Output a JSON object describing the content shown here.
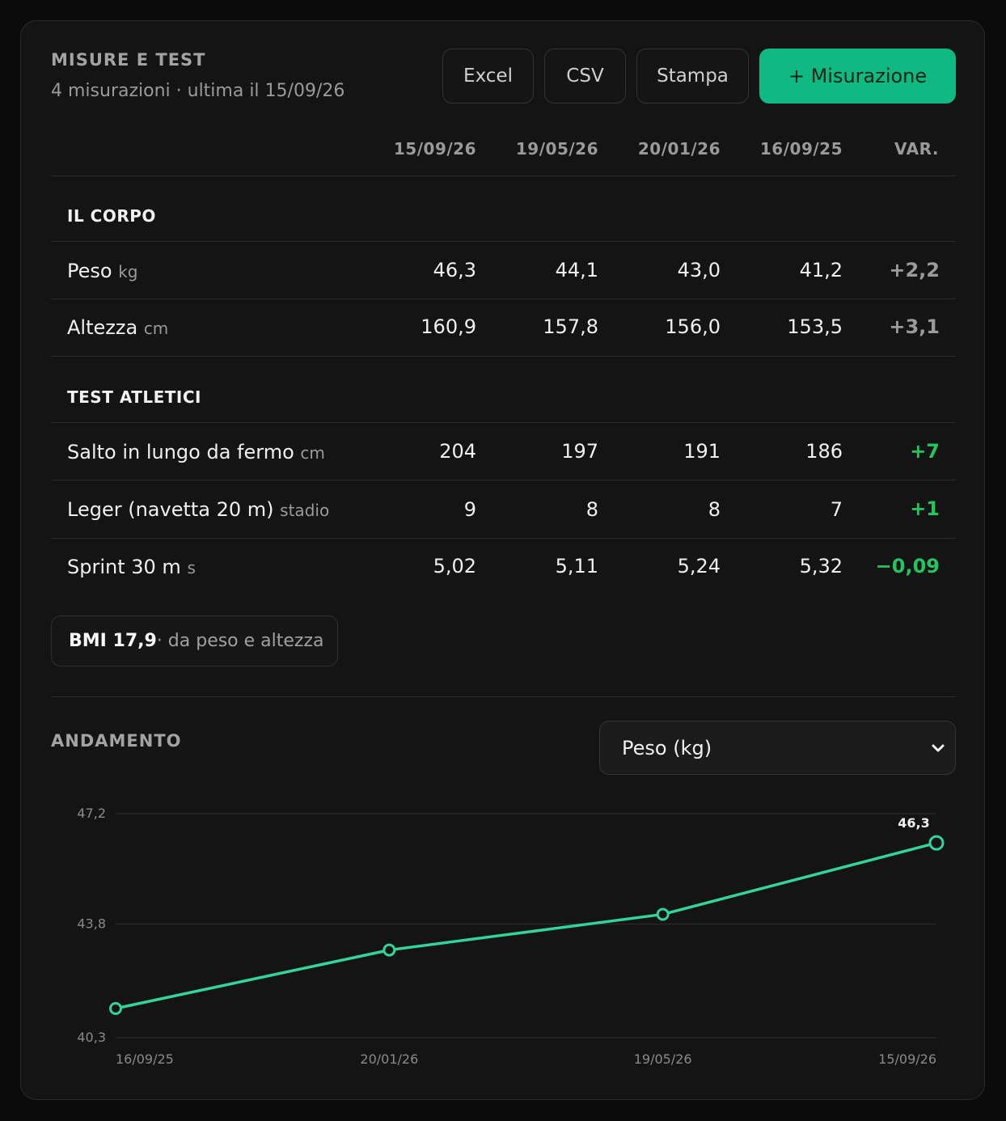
{
  "header": {
    "title": "MISURE E TEST",
    "subtitle": "4 misurazioni · ultima il 15/09/26"
  },
  "toolbar": {
    "excel_label": "Excel",
    "csv_label": "CSV",
    "print_label": "Stampa",
    "add_label": "+ Misurazione"
  },
  "table": {
    "columns": [
      "15/09/26",
      "19/05/26",
      "20/01/26",
      "16/09/25",
      "VAR."
    ],
    "sections": [
      {
        "title": "IL CORPO",
        "rows": [
          {
            "label": "Peso",
            "unit": "kg",
            "values": [
              "46,3",
              "44,1",
              "43,0",
              "41,2"
            ],
            "var": "+2,2",
            "var_tone": "neutral"
          },
          {
            "label": "Altezza",
            "unit": "cm",
            "values": [
              "160,9",
              "157,8",
              "156,0",
              "153,5"
            ],
            "var": "+3,1",
            "var_tone": "neutral"
          }
        ]
      },
      {
        "title": "TEST ATLETICI",
        "rows": [
          {
            "label": "Salto in lungo da fermo",
            "unit": "cm",
            "values": [
              "204",
              "197",
              "191",
              "186"
            ],
            "var": "+7",
            "var_tone": "positive"
          },
          {
            "label": "Leger (navetta 20 m)",
            "unit": "stadio",
            "values": [
              "9",
              "8",
              "8",
              "7"
            ],
            "var": "+1",
            "var_tone": "positive"
          },
          {
            "label": "Sprint 30 m",
            "unit": "s",
            "values": [
              "5,02",
              "5,11",
              "5,24",
              "5,32"
            ],
            "var": "−0,09",
            "var_tone": "positive"
          }
        ]
      }
    ]
  },
  "bmi": {
    "value": "BMI 17,9",
    "note": " · da peso e altezza"
  },
  "trend": {
    "title": "ANDAMENTO",
    "selected_metric": "Peso (kg)"
  },
  "colors": {
    "accent": "#10b981",
    "line": "#34d399",
    "positive": "#22c55e",
    "background": "#141414"
  },
  "chart_data": {
    "type": "line",
    "x": [
      "16/09/25",
      "20/01/26",
      "19/05/26",
      "15/09/26"
    ],
    "series": [
      {
        "values": [
          41.2,
          43.0,
          44.1,
          46.3
        ]
      }
    ],
    "y_ticks": [
      "47,2",
      "43,8",
      "40,3"
    ],
    "y_tick_values": [
      47.2,
      43.8,
      40.3
    ],
    "ylim": [
      40.3,
      47.2
    ],
    "last_point_label": "46,3",
    "grid": true,
    "legend": "none"
  }
}
